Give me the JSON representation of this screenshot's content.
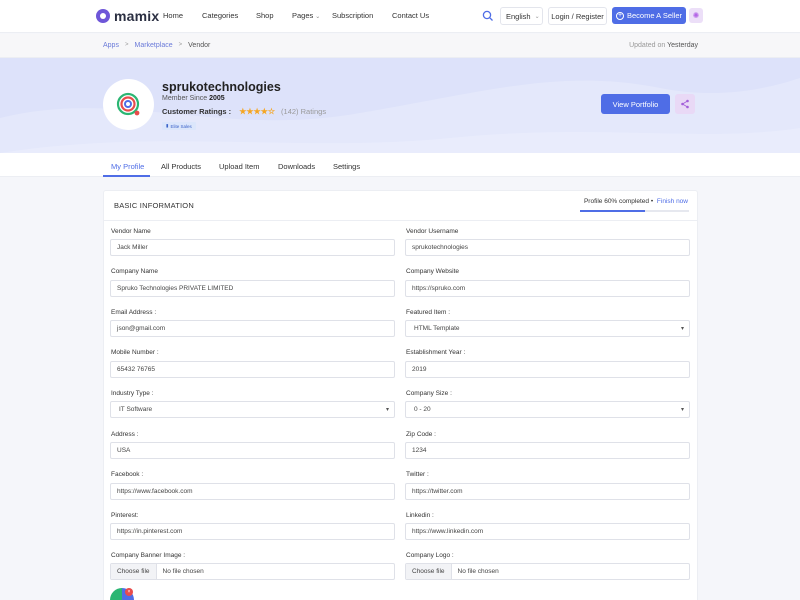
{
  "header": {
    "logo_text": "mamix",
    "nav": [
      "Home",
      "Categories",
      "Shop",
      "Pages",
      "Subscription",
      "Contact Us"
    ],
    "language": "English",
    "login_label": "Login / Register",
    "seller_label": "Become A Seller"
  },
  "breadcrumb": {
    "items": [
      "Apps",
      "Marketplace",
      "Vendor"
    ],
    "updated_label": "Updated on",
    "updated_value": "Yesterday"
  },
  "profile": {
    "name": "sprukotechnologies",
    "member_since_label": "Member Since",
    "member_since_year": "2005",
    "ratings_label": "Customer Ratings :",
    "stars": "★★★★☆",
    "rating_value": 3.5,
    "ratings_count": "(142) Ratings",
    "badge": "Elite Sales",
    "portfolio_button": "View Portfolio"
  },
  "tabs": [
    "My Profile",
    "All Products",
    "Upload Item",
    "Downloads",
    "Settings"
  ],
  "card": {
    "title": "BASIC INFORMATION",
    "progress_label": "Profile 60% completed",
    "progress_sep": "•",
    "progress_action": "Finish now",
    "progress_fraction": 0.6
  },
  "form": {
    "vendor_name": {
      "label": "Vendor Name",
      "value": "Jack Miller"
    },
    "vendor_username": {
      "label": "Vendor Username",
      "value": "sprukotechnologies"
    },
    "company_name": {
      "label": "Company Name",
      "value": "Spruko Technologies PRIVATE LIMITED"
    },
    "company_website": {
      "label": "Company Website",
      "value": "https://spruko.com"
    },
    "email": {
      "label": "Email Address :",
      "value": "json@gmail.com"
    },
    "featured_item": {
      "label": "Featured Item :",
      "value": "HTML Template"
    },
    "mobile": {
      "label": "Mobile Number :",
      "value": "65432 76765"
    },
    "establishment_year": {
      "label": "Establishment Year :",
      "value": "2019"
    },
    "industry_type": {
      "label": "Industry Type :",
      "value": "IT Software"
    },
    "company_size": {
      "label": "Company Size :",
      "value": "0 - 20"
    },
    "address": {
      "label": "Address :",
      "value": "USA"
    },
    "zip_code": {
      "label": "Zip Code :",
      "value": "1234"
    },
    "facebook": {
      "label": "Facebook :",
      "value": "https://www.facebook.com"
    },
    "twitter": {
      "label": "Twitter :",
      "value": "https://twitter.com"
    },
    "pinterest": {
      "label": "Pinterest:",
      "value": "https://in.pinterest.com"
    },
    "linkedin": {
      "label": "Linkedin :",
      "value": "https://www.linkedin.com"
    },
    "banner_image": {
      "label": "Company Banner Image :",
      "button": "Choose file",
      "status": "No file chosen"
    },
    "logo": {
      "label": "Company Logo :",
      "button": "Choose file",
      "status": "No file chosen"
    }
  },
  "colors": {
    "accent": "#4f6de6",
    "star": "#f5a623",
    "hero_bg": "#e4e8fb"
  },
  "icons": {
    "search": "search-icon",
    "gear": "gear-icon",
    "share": "share-icon",
    "plus": "plus-circle-icon"
  }
}
